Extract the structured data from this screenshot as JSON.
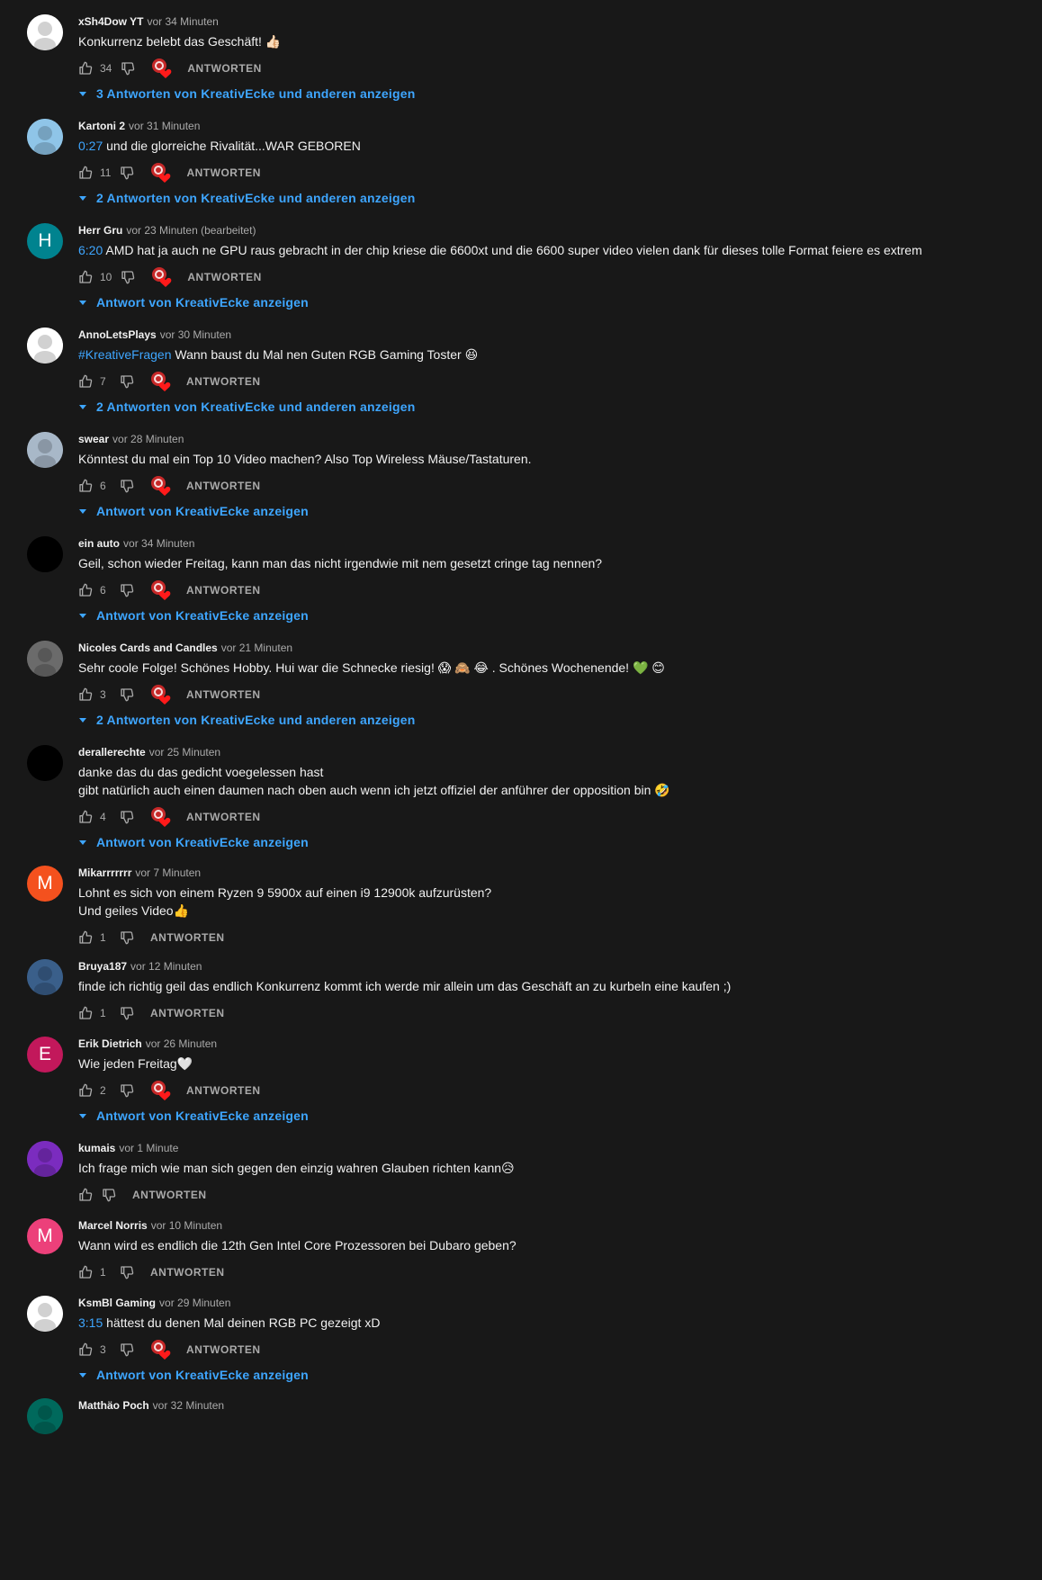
{
  "colors": {
    "background": "#181818",
    "text": "#f1f1f1",
    "muted": "#aaaaaa",
    "link": "#3ea6ff",
    "heart": "#e82929"
  },
  "icons": {
    "like": "thumbs-up-icon",
    "dislike": "thumbs-down-icon",
    "heart": "creator-heart-icon",
    "expand": "caret-down-icon"
  },
  "reply_label": "ANTWORTEN",
  "comments": [
    {
      "author": "xSh4Dow YT",
      "time": "vor 34 Minuten",
      "timestamp": "",
      "text": "Konkurrenz belebt das Geschäft! 👍🏻",
      "likes": "34",
      "hearted": true,
      "replies": "3 Antworten von KreativEcke und anderen anzeigen",
      "avatar_initial": "",
      "avatar_color": "#ffffff"
    },
    {
      "author": "Kartoni 2",
      "time": "vor 31 Minuten",
      "timestamp": "0:27",
      "text": " und die glorreiche Rivalität...WAR GEBOREN",
      "likes": "11",
      "hearted": true,
      "replies": "2 Antworten von KreativEcke und anderen anzeigen",
      "avatar_initial": "",
      "avatar_color": "#8fc5e8"
    },
    {
      "author": "Herr Gru",
      "time": "vor 23 Minuten (bearbeitet)",
      "timestamp": "6:20",
      "text": " AMD hat ja auch ne GPU raus gebracht in der chip kriese die 6600xt und die 6600 super video vielen dank für dieses tolle Format feiere es extrem",
      "likes": "10",
      "hearted": true,
      "replies": "Antwort von KreativEcke anzeigen",
      "avatar_initial": "H",
      "avatar_color": "#00838f"
    },
    {
      "author": "AnnoLetsPlays",
      "time": "vor 30 Minuten",
      "timestamp": "#KreativeFragen",
      "text": " Wann baust du Mal nen Guten RGB Gaming Toster 😆",
      "likes": "7",
      "hearted": true,
      "replies": "2 Antworten von KreativEcke und anderen anzeigen",
      "avatar_initial": "",
      "avatar_color": "#ffffff"
    },
    {
      "author": "swear",
      "time": "vor 28 Minuten",
      "timestamp": "",
      "text": "Könntest du mal ein Top 10 Video machen? Also Top Wireless Mäuse/Tastaturen.",
      "likes": "6",
      "hearted": true,
      "replies": "Antwort von KreativEcke anzeigen",
      "avatar_initial": "",
      "avatar_color": "#a8b8c8"
    },
    {
      "author": "ein auto",
      "time": "vor 34 Minuten",
      "timestamp": "",
      "text": "Geil, schon wieder Freitag, kann man das nicht irgendwie mit nem gesetzt cringe tag nennen?",
      "likes": "6",
      "hearted": true,
      "replies": "Antwort von KreativEcke anzeigen",
      "avatar_initial": "",
      "avatar_color": "#000000"
    },
    {
      "author": "Nicoles Cards and Candles",
      "time": "vor 21 Minuten",
      "timestamp": "",
      "text": "Sehr coole Folge! Schönes Hobby. Hui war die Schnecke riesig! 😱 🙈 😂 . Schönes Wochenende! 💚 😊",
      "likes": "3",
      "hearted": true,
      "replies": "2 Antworten von KreativEcke und anderen anzeigen",
      "avatar_initial": "",
      "avatar_color": "#6b6b6b"
    },
    {
      "author": "derallerechte",
      "time": "vor 25 Minuten",
      "timestamp": "",
      "text": "danke das du das gedicht voegelessen hast\ngibt natürlich auch einen daumen nach oben auch wenn ich jetzt offiziel der anführer der opposition bin 🤣",
      "likes": "4",
      "hearted": true,
      "replies": "Antwort von KreativEcke anzeigen",
      "avatar_initial": "",
      "avatar_color": "#000000"
    },
    {
      "author": "Mikarrrrrrr",
      "time": "vor 7 Minuten",
      "timestamp": "",
      "text": "Lohnt es sich von einem Ryzen 9 5900x auf einen i9 12900k aufzurüsten?\nUnd geiles Video👍",
      "likes": "1",
      "hearted": false,
      "replies": "",
      "avatar_initial": "M",
      "avatar_color": "#f4511e"
    },
    {
      "author": "Bruya187",
      "time": "vor 12 Minuten",
      "timestamp": "",
      "text": "finde ich richtig geil das endlich Konkurrenz kommt ich werde mir allein um das Geschäft an zu kurbeln eine kaufen ;)",
      "likes": "1",
      "hearted": false,
      "replies": "",
      "avatar_initial": "",
      "avatar_color": "#3a5f8a"
    },
    {
      "author": "Erik Dietrich",
      "time": "vor 26 Minuten",
      "timestamp": "",
      "text": "Wie jeden Freitag🤍",
      "likes": "2",
      "hearted": true,
      "replies": "Antwort von KreativEcke anzeigen",
      "avatar_initial": "E",
      "avatar_color": "#c2185b"
    },
    {
      "author": "kumais",
      "time": "vor 1 Minute",
      "timestamp": "",
      "text": "Ich frage mich wie man sich gegen den einzig wahren Glauben richten kann😥",
      "likes": "",
      "hearted": false,
      "replies": "",
      "avatar_initial": "",
      "avatar_color": "#7b2cbf"
    },
    {
      "author": "Marcel Norris",
      "time": "vor 10 Minuten",
      "timestamp": "",
      "text": "Wann wird es endlich die 12th Gen Intel Core Prozessoren bei Dubaro geben?",
      "likes": "1",
      "hearted": false,
      "replies": "",
      "avatar_initial": "M",
      "avatar_color": "#ec407a"
    },
    {
      "author": "KsmBl Gaming",
      "time": "vor 29 Minuten",
      "timestamp": "3:15",
      "text": " hättest du denen Mal deinen RGB PC gezeigt xD",
      "likes": "3",
      "hearted": true,
      "replies": "Antwort von KreativEcke anzeigen",
      "avatar_initial": "",
      "avatar_color": "#ffffff"
    },
    {
      "author": "Matthäo Poch",
      "time": "vor 32 Minuten",
      "timestamp": "",
      "text": "",
      "likes": "",
      "hearted": false,
      "replies": "",
      "avatar_initial": "",
      "avatar_color": "#00695c"
    }
  ]
}
